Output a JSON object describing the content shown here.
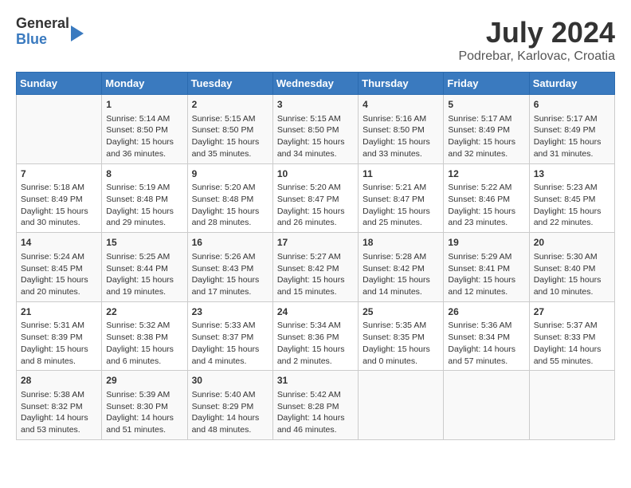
{
  "header": {
    "logo_line1": "General",
    "logo_line2": "Blue",
    "title": "July 2024",
    "subtitle": "Podrebar, Karlovac, Croatia"
  },
  "weekdays": [
    "Sunday",
    "Monday",
    "Tuesday",
    "Wednesday",
    "Thursday",
    "Friday",
    "Saturday"
  ],
  "weeks": [
    [
      {
        "day": "",
        "info": ""
      },
      {
        "day": "1",
        "info": "Sunrise: 5:14 AM\nSunset: 8:50 PM\nDaylight: 15 hours\nand 36 minutes."
      },
      {
        "day": "2",
        "info": "Sunrise: 5:15 AM\nSunset: 8:50 PM\nDaylight: 15 hours\nand 35 minutes."
      },
      {
        "day": "3",
        "info": "Sunrise: 5:15 AM\nSunset: 8:50 PM\nDaylight: 15 hours\nand 34 minutes."
      },
      {
        "day": "4",
        "info": "Sunrise: 5:16 AM\nSunset: 8:50 PM\nDaylight: 15 hours\nand 33 minutes."
      },
      {
        "day": "5",
        "info": "Sunrise: 5:17 AM\nSunset: 8:49 PM\nDaylight: 15 hours\nand 32 minutes."
      },
      {
        "day": "6",
        "info": "Sunrise: 5:17 AM\nSunset: 8:49 PM\nDaylight: 15 hours\nand 31 minutes."
      }
    ],
    [
      {
        "day": "7",
        "info": "Sunrise: 5:18 AM\nSunset: 8:49 PM\nDaylight: 15 hours\nand 30 minutes."
      },
      {
        "day": "8",
        "info": "Sunrise: 5:19 AM\nSunset: 8:48 PM\nDaylight: 15 hours\nand 29 minutes."
      },
      {
        "day": "9",
        "info": "Sunrise: 5:20 AM\nSunset: 8:48 PM\nDaylight: 15 hours\nand 28 minutes."
      },
      {
        "day": "10",
        "info": "Sunrise: 5:20 AM\nSunset: 8:47 PM\nDaylight: 15 hours\nand 26 minutes."
      },
      {
        "day": "11",
        "info": "Sunrise: 5:21 AM\nSunset: 8:47 PM\nDaylight: 15 hours\nand 25 minutes."
      },
      {
        "day": "12",
        "info": "Sunrise: 5:22 AM\nSunset: 8:46 PM\nDaylight: 15 hours\nand 23 minutes."
      },
      {
        "day": "13",
        "info": "Sunrise: 5:23 AM\nSunset: 8:45 PM\nDaylight: 15 hours\nand 22 minutes."
      }
    ],
    [
      {
        "day": "14",
        "info": "Sunrise: 5:24 AM\nSunset: 8:45 PM\nDaylight: 15 hours\nand 20 minutes."
      },
      {
        "day": "15",
        "info": "Sunrise: 5:25 AM\nSunset: 8:44 PM\nDaylight: 15 hours\nand 19 minutes."
      },
      {
        "day": "16",
        "info": "Sunrise: 5:26 AM\nSunset: 8:43 PM\nDaylight: 15 hours\nand 17 minutes."
      },
      {
        "day": "17",
        "info": "Sunrise: 5:27 AM\nSunset: 8:42 PM\nDaylight: 15 hours\nand 15 minutes."
      },
      {
        "day": "18",
        "info": "Sunrise: 5:28 AM\nSunset: 8:42 PM\nDaylight: 15 hours\nand 14 minutes."
      },
      {
        "day": "19",
        "info": "Sunrise: 5:29 AM\nSunset: 8:41 PM\nDaylight: 15 hours\nand 12 minutes."
      },
      {
        "day": "20",
        "info": "Sunrise: 5:30 AM\nSunset: 8:40 PM\nDaylight: 15 hours\nand 10 minutes."
      }
    ],
    [
      {
        "day": "21",
        "info": "Sunrise: 5:31 AM\nSunset: 8:39 PM\nDaylight: 15 hours\nand 8 minutes."
      },
      {
        "day": "22",
        "info": "Sunrise: 5:32 AM\nSunset: 8:38 PM\nDaylight: 15 hours\nand 6 minutes."
      },
      {
        "day": "23",
        "info": "Sunrise: 5:33 AM\nSunset: 8:37 PM\nDaylight: 15 hours\nand 4 minutes."
      },
      {
        "day": "24",
        "info": "Sunrise: 5:34 AM\nSunset: 8:36 PM\nDaylight: 15 hours\nand 2 minutes."
      },
      {
        "day": "25",
        "info": "Sunrise: 5:35 AM\nSunset: 8:35 PM\nDaylight: 15 hours\nand 0 minutes."
      },
      {
        "day": "26",
        "info": "Sunrise: 5:36 AM\nSunset: 8:34 PM\nDaylight: 14 hours\nand 57 minutes."
      },
      {
        "day": "27",
        "info": "Sunrise: 5:37 AM\nSunset: 8:33 PM\nDaylight: 14 hours\nand 55 minutes."
      }
    ],
    [
      {
        "day": "28",
        "info": "Sunrise: 5:38 AM\nSunset: 8:32 PM\nDaylight: 14 hours\nand 53 minutes."
      },
      {
        "day": "29",
        "info": "Sunrise: 5:39 AM\nSunset: 8:30 PM\nDaylight: 14 hours\nand 51 minutes."
      },
      {
        "day": "30",
        "info": "Sunrise: 5:40 AM\nSunset: 8:29 PM\nDaylight: 14 hours\nand 48 minutes."
      },
      {
        "day": "31",
        "info": "Sunrise: 5:42 AM\nSunset: 8:28 PM\nDaylight: 14 hours\nand 46 minutes."
      },
      {
        "day": "",
        "info": ""
      },
      {
        "day": "",
        "info": ""
      },
      {
        "day": "",
        "info": ""
      }
    ]
  ]
}
